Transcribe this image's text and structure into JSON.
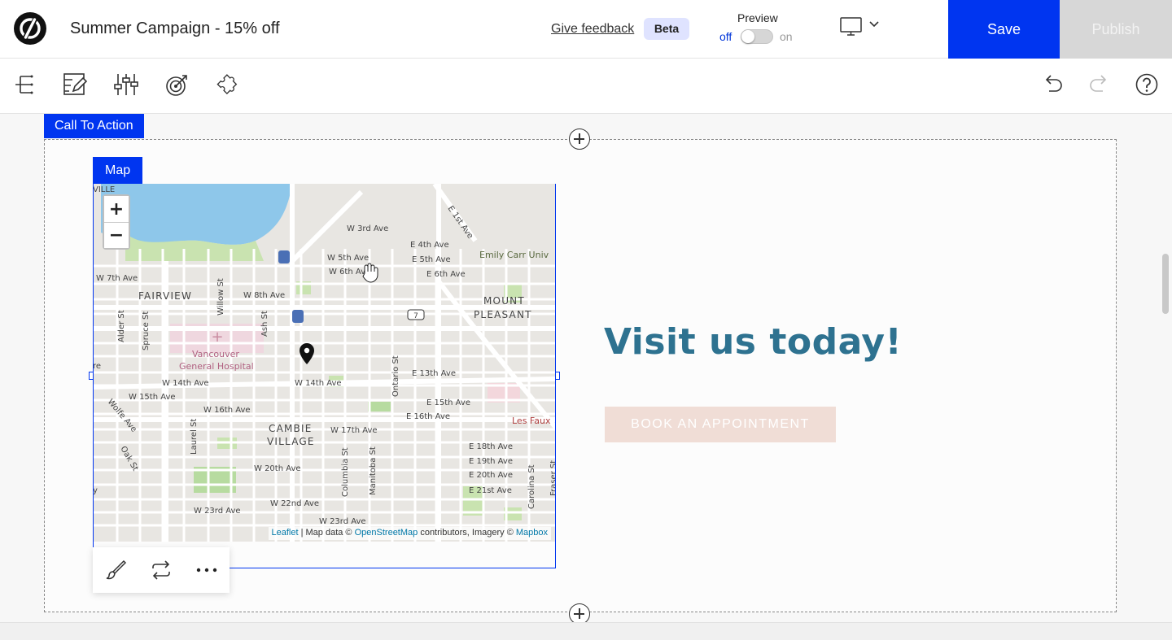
{
  "header": {
    "title": "Summer Campaign - 15% off",
    "feedback_link": "Give feedback",
    "beta_badge": "Beta",
    "preview_label": "Preview",
    "preview_off": "off",
    "preview_on": "on",
    "save_label": "Save",
    "publish_label": "Publish"
  },
  "toolbar": {
    "icons": [
      "tree-icon",
      "edit-layout-icon",
      "sliders-icon",
      "target-icon",
      "puzzle-icon",
      "undo-icon",
      "redo-icon",
      "help-icon"
    ]
  },
  "canvas": {
    "section_tag": "Call To Action",
    "map_tag": "Map",
    "zoom_in": "+",
    "zoom_out": "−",
    "attribution": {
      "leaflet": "Leaflet",
      "sep": " | ",
      "text1": "Map data © ",
      "osm": "OpenStreetMap",
      "text2": " contributors, Imagery © ",
      "mapbox": "Mapbox"
    },
    "map_labels": {
      "fairview": "FAIRVIEW",
      "mount": "MOUNT",
      "pleasant": "PLEASANT",
      "cambie": "CAMBIE",
      "village": "VILLAGE",
      "hospital1": "Vancouver",
      "hospital2": "General Hospital",
      "emily": "Emily Carr Univ",
      "lesfaux": "Les Faux",
      "w3": "W 3rd Ave",
      "w5": "W 5th Ave",
      "w6": "W 6th Ave",
      "w7": "W 7th Ave",
      "w8": "W 8th Ave",
      "w14": "W 14th Ave",
      "w14b": "W 14th Ave",
      "w15": "W 15th Ave",
      "w16": "W 16th Ave",
      "w17": "W 17th Ave",
      "w20": "W 20th Ave",
      "w22": "W 22nd Ave",
      "w23": "W 23rd Ave",
      "w23b": "W 23rd Ave",
      "e1": "E 1st Ave",
      "e4": "E 4th Ave",
      "e5": "E 5th Ave",
      "e6": "E 6th Ave",
      "e13": "E 13th Ave",
      "e15": "E 15th Ave",
      "e16": "E 16th Ave",
      "e18": "E 18th Ave",
      "e19": "E 19th Ave",
      "e20": "E 20th Ave",
      "e21": "E 21st Ave",
      "alder": "Alder St",
      "spruce": "Spruce St",
      "willow": "Willow St",
      "ash": "Ash St",
      "laurel": "Laurel St",
      "oak": "Oak St",
      "wolfe": "Wolfe Ave",
      "columbia": "Columbia St",
      "manitoba": "Manitoba St",
      "ontario": "Ontario St",
      "carolina": "Carolina St",
      "fraser": "Fraser St",
      "hwy": "7",
      "re": "re",
      "y": "y",
      "ville": "VILLE"
    },
    "headline": "Visit us today!",
    "cta_button": "BOOK AN APPOINTMENT"
  },
  "colors": {
    "accent": "#0035f0",
    "headline": "#2e7290",
    "cta": "#f0ddd6"
  }
}
